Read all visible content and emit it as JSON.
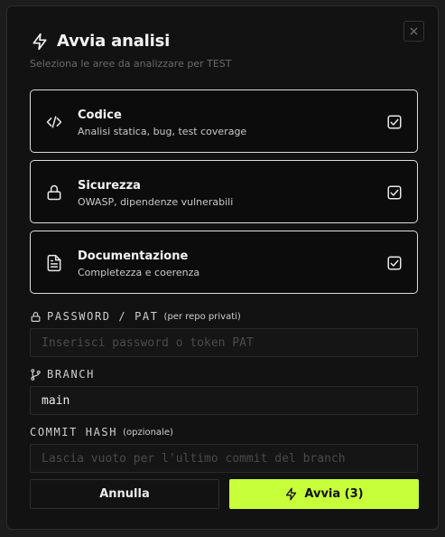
{
  "dialog": {
    "title": "Avvia analisi",
    "subtitle": "Seleziona le aree da analizzare per TEST",
    "close_icon": "×",
    "accent": "#c7ff3a"
  },
  "areas": [
    {
      "name": "Codice",
      "description": "Analisi statica, bug, test coverage",
      "icon": "code-icon",
      "checked": true
    },
    {
      "name": "Sicurezza",
      "description": "OWASP, dipendenze vulnerabili",
      "icon": "lock-icon",
      "checked": true
    },
    {
      "name": "Documentazione",
      "description": "Completezza e coerenza",
      "icon": "document-icon",
      "checked": true
    }
  ],
  "password": {
    "label": "PASSWORD / PAT",
    "note": "(per repo privati)",
    "placeholder": "Inserisci password o token PAT"
  },
  "branch": {
    "label": "BRANCH",
    "value": "main"
  },
  "commit": {
    "label": "COMMIT HASH",
    "note": "(opzionale)",
    "placeholder": "Lascia vuoto per l'ultimo commit del branch"
  },
  "actions": {
    "cancel_label": "Annulla",
    "start_label": "Avvia (3)"
  }
}
